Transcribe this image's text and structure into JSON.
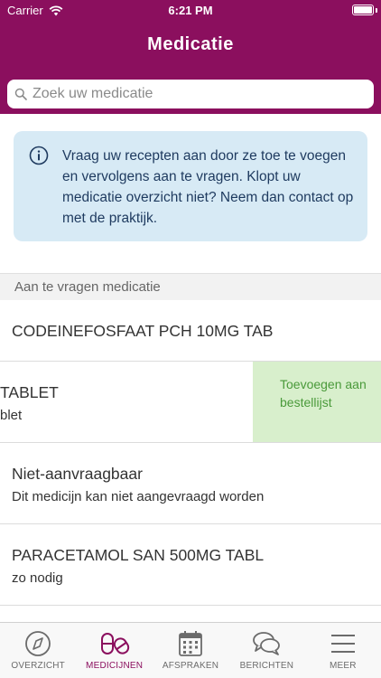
{
  "status_bar": {
    "carrier": "Carrier",
    "time": "6:21 PM"
  },
  "header": {
    "title": "Medicatie"
  },
  "search": {
    "placeholder": "Zoek uw medicatie"
  },
  "info": {
    "text": "Vraag uw recepten aan door ze toe te voegen en vervolgens aan te vragen. Klopt uw medicatie overzicht niet? Neem dan contact op met de praktijk."
  },
  "section": {
    "title": "Aan te vragen medicatie"
  },
  "medications": [
    {
      "title": "CODEINEFOSFAAT PCH 10MG TAB",
      "subtitle": ""
    },
    {
      "title": "TABLET",
      "subtitle": "blet",
      "swipe_action": "Toevoegen aan bestellijst"
    },
    {
      "title": "Niet-aanvraagbaar",
      "subtitle": "Dit medicijn kan niet aangevraagd worden"
    },
    {
      "title": "PARACETAMOL SAN 500MG TABL",
      "subtitle": "zo nodig"
    }
  ],
  "tabbar": {
    "tabs": [
      {
        "label": "OVERZICHT",
        "icon": "compass-icon",
        "active": false
      },
      {
        "label": "MEDICIJNEN",
        "icon": "pills-icon",
        "active": true
      },
      {
        "label": "AFSPRAKEN",
        "icon": "calendar-icon",
        "active": false
      },
      {
        "label": "BERICHTEN",
        "icon": "chat-icon",
        "active": false
      },
      {
        "label": "MEER",
        "icon": "menu-icon",
        "active": false
      }
    ]
  },
  "colors": {
    "brand": "#8b0f5e",
    "info_bg": "#d7eaf5",
    "swipe_bg": "#d8efcc",
    "swipe_text": "#4a9a3a"
  }
}
